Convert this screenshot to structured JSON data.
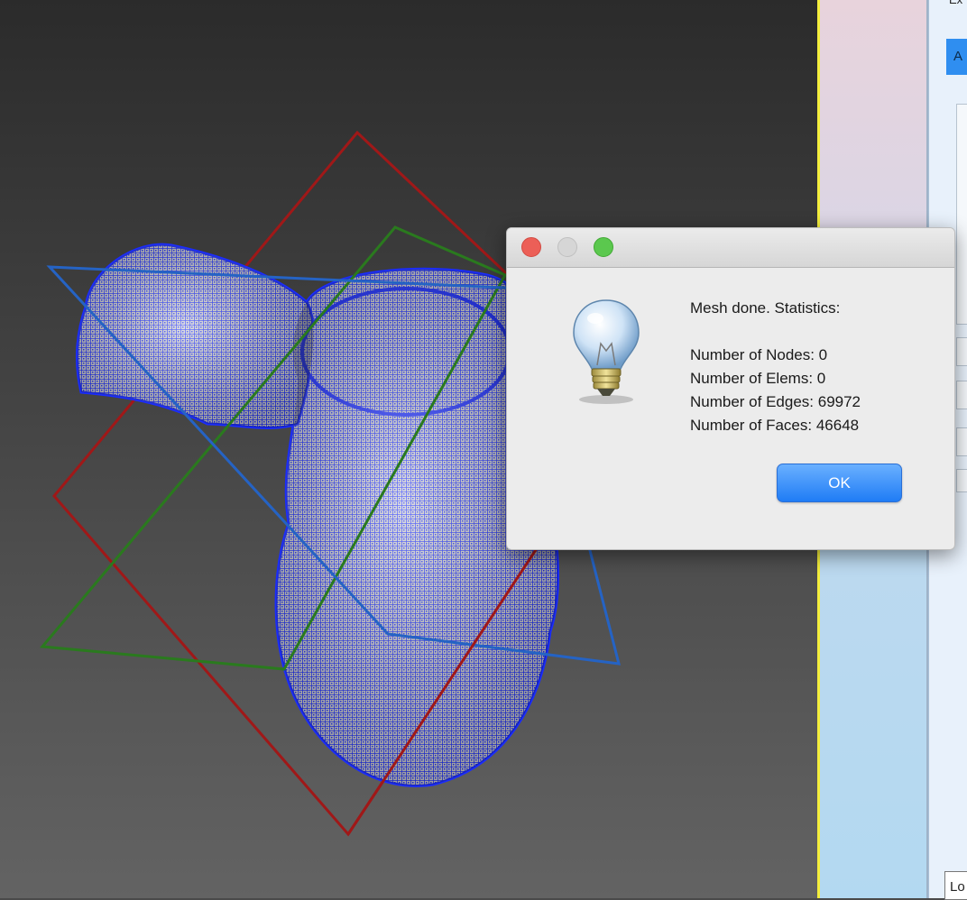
{
  "viewport": {
    "model": "mesh-3d-model",
    "colors": {
      "wire": "#1a2cff",
      "surface": "#cfcfcf",
      "plane_x": "#a01818",
      "plane_y": "#2a7a1e",
      "plane_z": "#2563c4"
    }
  },
  "dialog": {
    "icon": "lightbulb-icon",
    "message_title": "Mesh done. Statistics:",
    "stats": [
      {
        "label": "Number of Nodes: 0"
      },
      {
        "label": "Number of Elems: 0"
      },
      {
        "label": "Number of Edges: 69972"
      },
      {
        "label": "Number of Faces: 46648"
      }
    ],
    "ok_label": "OK"
  },
  "right_panel": {
    "top_label": "Ex",
    "tab_label": "A",
    "bottom_field": "Lo"
  }
}
